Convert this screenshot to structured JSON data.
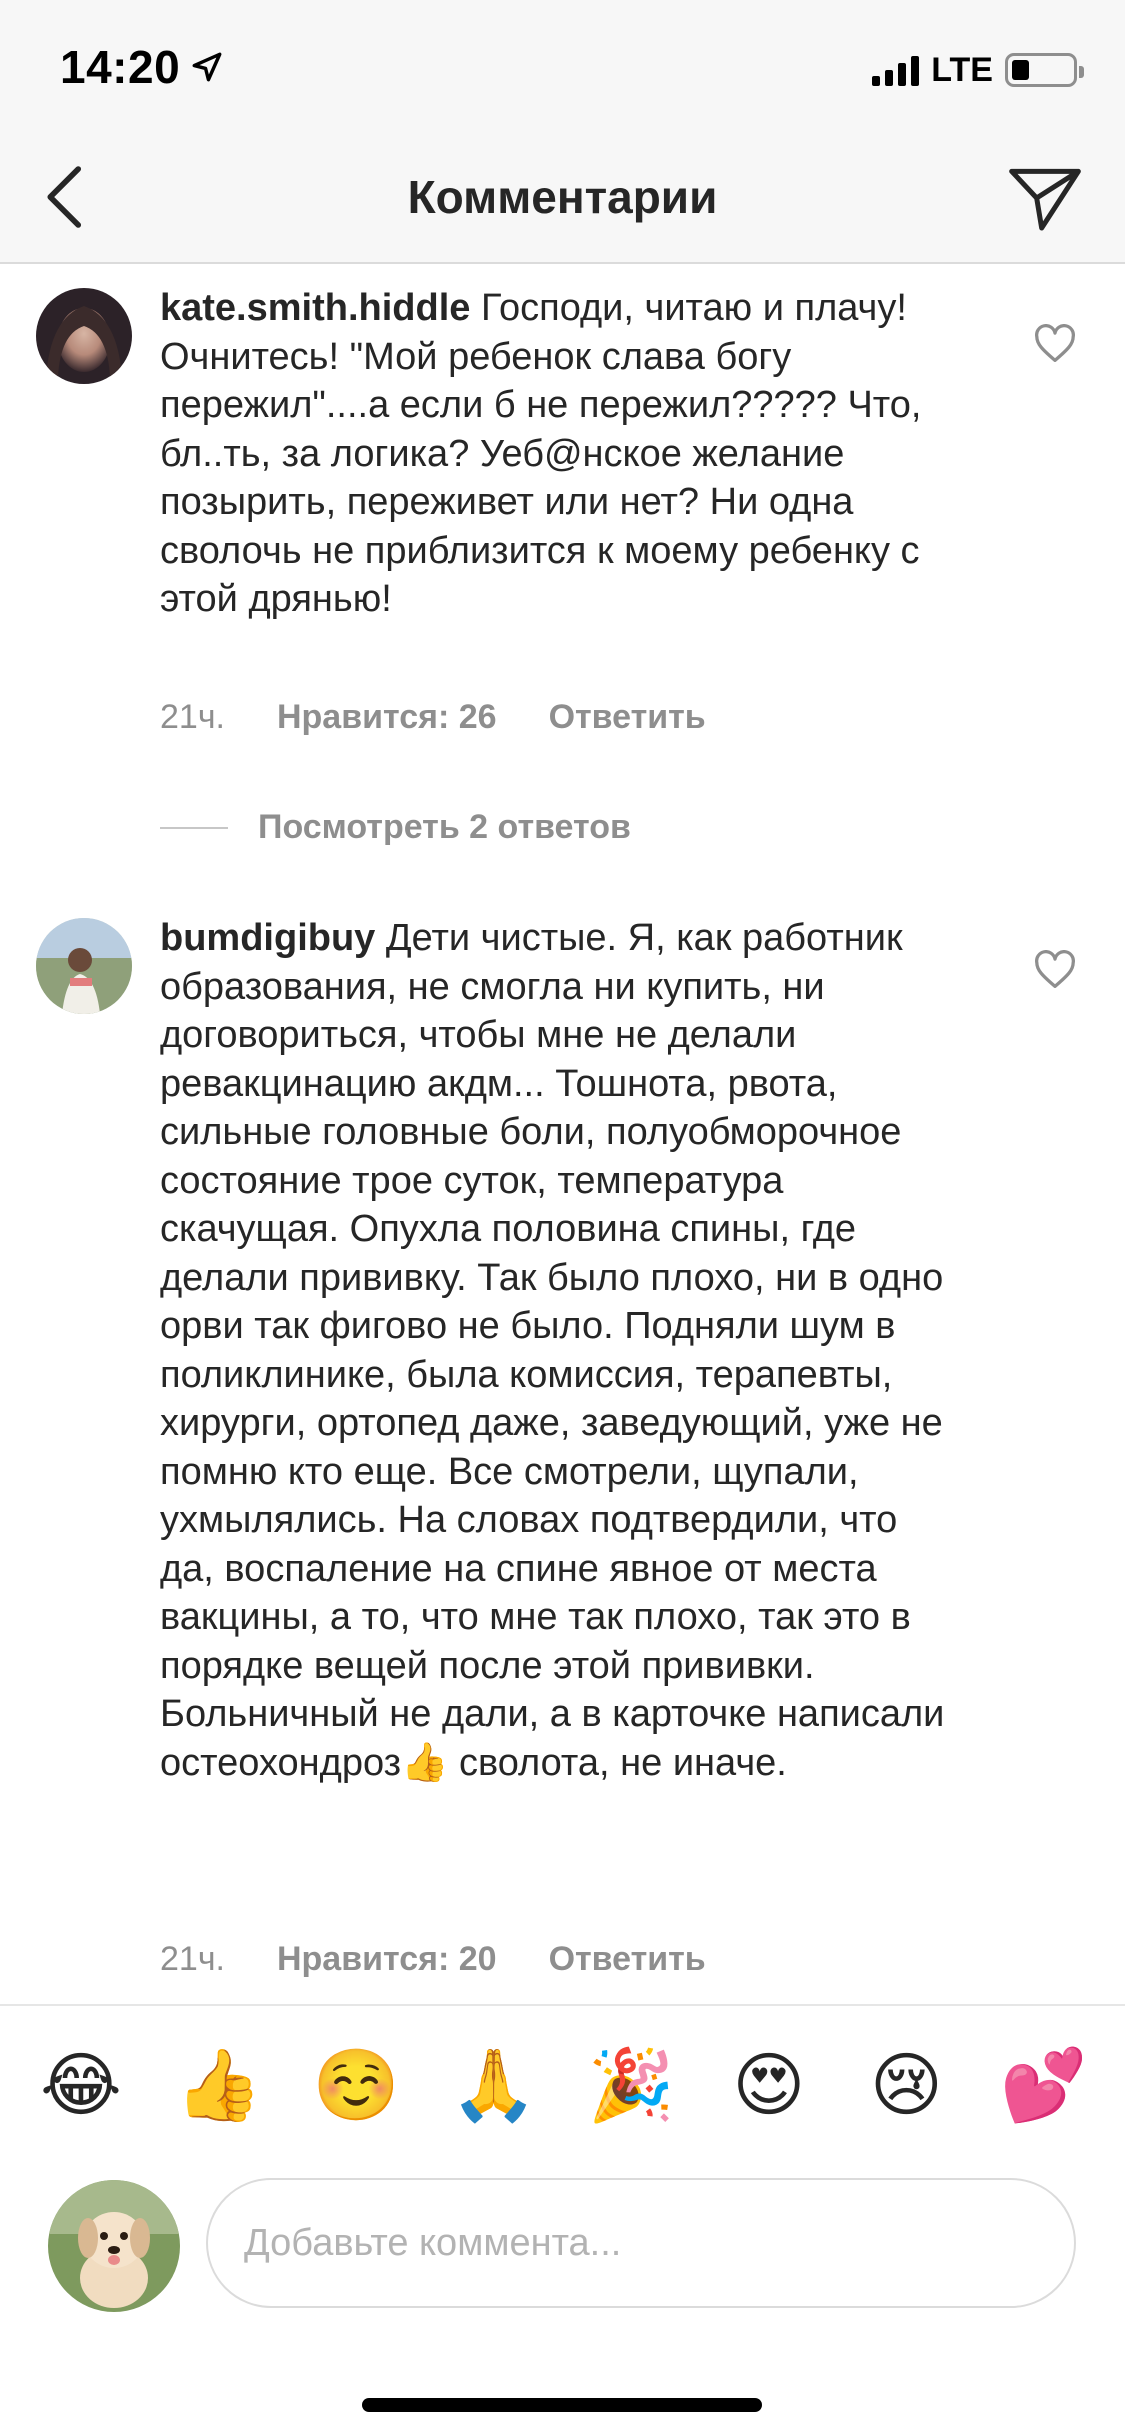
{
  "status_bar": {
    "time": "14:20",
    "network": "LTE",
    "battery_level": 0.3
  },
  "header": {
    "title": "Комментарии"
  },
  "comments": [
    {
      "username": "kate.smith.hiddle",
      "text": "Господи, читаю и плачу! Очнитесь! \"Мой ребенок слава богу пережил\"....а если б не пережил????? Что, бл..ть, за логика? Уеб@нское желание позырить, переживет или нет? Ни одна сволочь не приблизится к моему ребенку с этой дрянью!",
      "time": "21ч.",
      "likes": "Нравится: 26",
      "reply": "Ответить",
      "view_replies": "Посмотреть 2 ответов"
    },
    {
      "username": "bumdigibuy",
      "text": "Дети чистые. Я, как работник образования,  не смогла ни купить, ни договориться, чтобы мне не делали ревакцинацию акдм... Тошнота, рвота, сильные головные боли, полуобморочное состояние трое суток, температура скачущая. Опухла половина спины, где делали прививку. Так было плохо, ни в одно орви так фигово не было. Подняли шум в поликлинике, была комиссия, терапевты, хирурги, ортопед даже, заведующий, уже не помню кто еще. Все смотрели,  щупали, ухмылялись. На словах подтвердили, что да, воспаление на спине явное от места вакцины, а то, что мне так плохо, так это в порядке вещей после этой прививки. Больничный не дали,  а в карточке написали остеохондроз👍 сволота, не иначе.",
      "time": "21ч.",
      "likes": "Нравится: 20",
      "reply": "Ответить"
    }
  ],
  "emoji_bar": [
    "😂",
    "👍",
    "☺️",
    "🙏",
    "🎉",
    "😍",
    "😢",
    "💕"
  ],
  "composer": {
    "placeholder": "Добавьте коммента..."
  },
  "icons": {
    "back": "chevron-left-icon",
    "send": "paper-plane-icon",
    "like": "heart-outline-icon",
    "location": "location-arrow-icon"
  },
  "colors": {
    "text": "#262626",
    "secondary": "#8e8e8e",
    "divider": "#dbdbdb",
    "header_bg": "#f7f7f7"
  }
}
